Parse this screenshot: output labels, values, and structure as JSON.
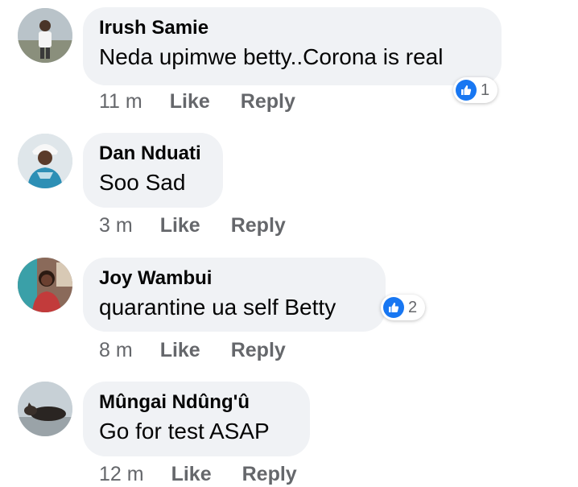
{
  "comments": [
    {
      "author": "Irush Samie",
      "text": "Neda upimwe betty..Corona is real",
      "time": "11 m",
      "like_label": "Like",
      "reply_label": "Reply",
      "reactions": "1",
      "avatar_icon": "person-photo-avatar"
    },
    {
      "author": "Dan Nduati",
      "text": "Soo Sad",
      "time": "3 m",
      "like_label": "Like",
      "reply_label": "Reply",
      "avatar_icon": "person-photo-avatar"
    },
    {
      "author": "Joy Wambui",
      "text": "quarantine ua self Betty",
      "time": "8 m",
      "like_label": "Like",
      "reply_label": "Reply",
      "reactions": "2",
      "avatar_icon": "person-photo-avatar"
    },
    {
      "author": "Mûngai Ndûng'û",
      "text": "Go for test ASAP",
      "time": "12 m",
      "like_label": "Like",
      "reply_label": "Reply",
      "avatar_icon": "dog-photo-avatar"
    }
  ],
  "colors": {
    "bubble": "#f0f2f5",
    "meta_text": "#65676b",
    "like_blue": "#1877f2"
  }
}
